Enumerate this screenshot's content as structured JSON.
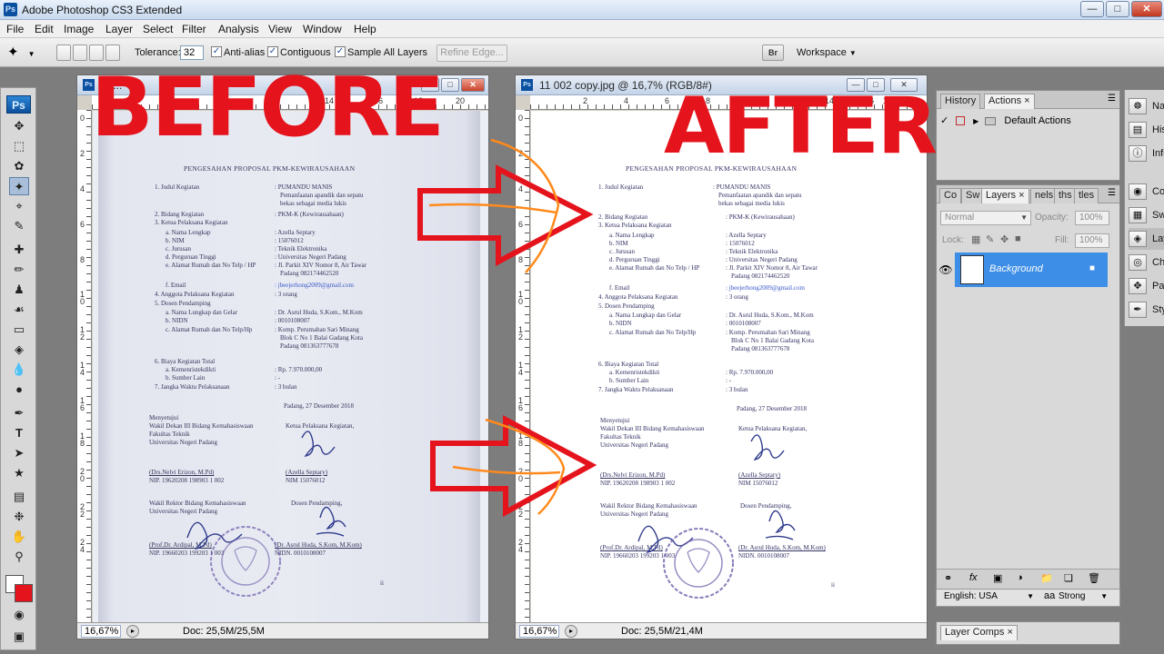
{
  "app": {
    "window_title": "Adobe Photoshop CS3 Extended",
    "logo": "Ps",
    "icon_label": "Ps"
  },
  "menu": [
    "File",
    "Edit",
    "Image",
    "Layer",
    "Select",
    "Filter",
    "Analysis",
    "View",
    "Window",
    "Help"
  ],
  "options": {
    "tolerance_label": "Tolerance:",
    "tolerance_value": "32",
    "anti_alias": "Anti-alias",
    "contiguous": "Contiguous",
    "sample_all_layers": "Sample All Layers",
    "refine_edge": "Refine Edge...",
    "workspace": "Workspace",
    "bridge_label": "Br"
  },
  "docs": {
    "before": {
      "title": "12...",
      "zoom": "16,67%",
      "doc_info": "Doc: 25,5M/25,5M"
    },
    "after": {
      "title": "11 002 copy.jpg @ 16,7% (RGB/8#)",
      "zoom": "16,67%",
      "doc_info": "Doc: 25,5M/21,4M"
    }
  },
  "ruler": {
    "h_before": [
      "14",
      "16",
      "18",
      "20"
    ],
    "h_after": [
      "2",
      "4",
      "6",
      "8",
      "10",
      "12",
      "14",
      "16",
      "18",
      "20"
    ],
    "v": [
      "0",
      "2",
      "4",
      "6",
      "8",
      "1 0",
      "1 2",
      "1 4",
      "1 6",
      "1 8",
      "2 0",
      "2 2",
      "2 4"
    ]
  },
  "overlay": {
    "before": "BEFORE",
    "after": "AFTER"
  },
  "document": {
    "heading": "PENGESAHAN PROPOSAL PKM-KEWIRAUSAHAAN",
    "l1": "1.  Judul Kegiatan",
    "v1a": ": PUMANDU MANIS",
    "v1b": "Pemanfaatan apandik dan sepatu",
    "v1c": "bekas sebagai media lukis",
    "l2": "2.  Bidang Kegiatan",
    "v2": ": PKM-K (Kewirausahaan)",
    "l3": "3.  Ketua Pelaksana Kegiatan",
    "l3a": "a.  Nama Lengkap",
    "v3a": ": Azella Septary",
    "l3b": "b.  NIM",
    "v3b": ": 15076012",
    "l3c": "c.  Jurusan",
    "v3c": ": Teknik Elektronika",
    "l3d": "d.  Perguruan Tinggi",
    "v3d": ": Universitas Negeri Padang",
    "l3e": "e.  Alamat Rumah dan No Telp / HP",
    "v3e1": ": Jl. Parkit XIV Nomor 8, Air Tawar",
    "v3e2": "Padang 082174462520",
    "l3f": "f.  Email",
    "v3f": ": jbeejerhong2009@gmail.com",
    "l4": "4.  Anggota Pelaksana Kegiatan",
    "v4": ": 3 orang",
    "l5": "5.  Dosen Pendamping",
    "l5a": "a.  Nama Lungkap dan Gelar",
    "v5a": ": Dr. Asrul Huda, S.Kom., M.Kom",
    "l5b": "b.  NIDN",
    "v5b": ": 0010108007",
    "l5c": "c.  Alamat Rumah dan No Telp/Hp",
    "v5c1": ": Komp. Perumahan Sari Minang",
    "v5c2": "Blok C No 1 Balai Gadang Kota",
    "v5c3": "Padang 081363777678",
    "l6": "6.  Biaya Kegiatan Total",
    "l6a": "a.  Kemenristekdikti",
    "v6a": ": Rp. 7.970.000,00",
    "l6b": "b.  Sumber Lain",
    "v6b": ": -",
    "l7": "7.  Jangka Waktu Pelaksanaan",
    "v7": ": 3 bulan",
    "date": "Padang, 27 Desember 2018",
    "approve": "Menyetujui",
    "wd_title": "Wakil Dekan III Bidang Kemahasiswaan",
    "wd_fac": "Fakultas Teknik",
    "wd_univ": "Universitas Negeri Padang",
    "ketua_title": "Ketua Pelaksana Kegiatan,",
    "wd_name": "(Drs.Nelvi Erizon, M.Pd)",
    "wd_nip": "NIP. 19620208 198903 1 002",
    "ketua_name": "(Azella Septary)",
    "ketua_nim": "NIM 15076012",
    "wr_title": "Wakil Rektor Bidang Kemahasiswaan",
    "wr_univ": "Universitas Negeri Padang",
    "dosen_title": "Dosen Pendamping,",
    "wr_name": "(Prof.Dr. Ardipal, M.Pd)",
    "wr_nip": "NIP. 19660203 199203 1 003",
    "dosen_name": "(Dr. Asrul Huda, S.Kom, M.Kom)",
    "dosen_nidn": "NIDN. 0010108007",
    "page_num": "ii"
  },
  "panels": {
    "history_tab": "History",
    "actions_tab": "Actions",
    "default_actions": "Default Actions",
    "layers_tabs": [
      "Co",
      "Sw",
      "Layers",
      "nels",
      "ths",
      "tles"
    ],
    "blend_mode": "Normal",
    "opacity_label": "Opacity:",
    "opacity_value": "100%",
    "lock_label": "Lock:",
    "fill_label": "Fill:",
    "fill_value": "100%",
    "layer_name": "Background",
    "dock": [
      "Na",
      "His",
      "Info",
      "Co",
      "Sw",
      "Lay",
      "Ch",
      "Pat",
      "Sty"
    ],
    "language": "English: USA",
    "aa_mode": "Strong",
    "layer_comps": "Layer Comps"
  },
  "colors": {
    "accent_red": "#e5131c",
    "arrow_orange": "#ff8a1c",
    "layer_selected": "#3d8ee6"
  }
}
